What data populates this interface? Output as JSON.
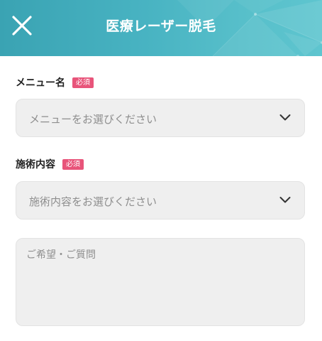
{
  "header": {
    "title": "医療レーザー脱毛",
    "close_icon": "close-icon",
    "background_color": "#48b3c2"
  },
  "form": {
    "menu": {
      "label": "メニュー名",
      "badge": "必須",
      "selected": "メニューをお選びください",
      "icon": "chevron-down-icon"
    },
    "treatment": {
      "label": "施術内容",
      "badge": "必須",
      "selected": "施術内容をお選びください",
      "icon": "chevron-down-icon"
    },
    "request": {
      "placeholder": "ご希望・ご質問"
    }
  },
  "colors": {
    "accent": "#48b3c2",
    "required_badge": "#e8547a",
    "field_background": "#efefef"
  }
}
